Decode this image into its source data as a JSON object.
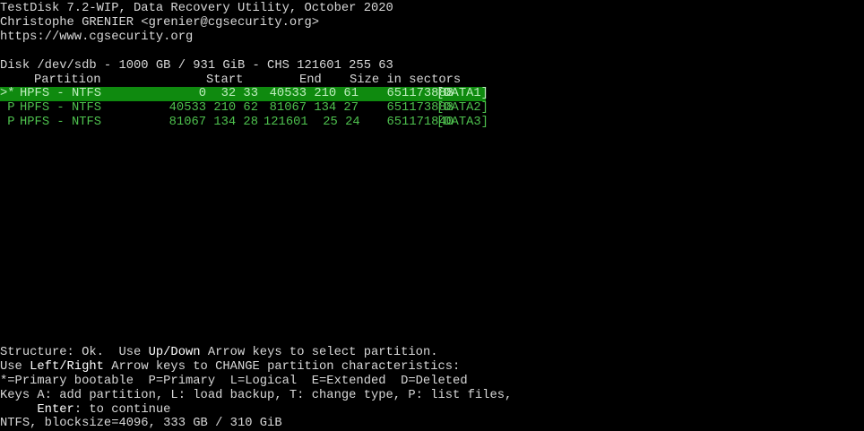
{
  "header": {
    "title": "TestDisk 7.2-WIP, Data Recovery Utility, October 2020",
    "author": "Christophe GRENIER <grenier@cgsecurity.org>",
    "url": "https://www.cgsecurity.org"
  },
  "disk_info": "Disk /dev/sdb - 1000 GB / 931 GiB - CHS 121601 255 63",
  "columns": {
    "partition": "Partition",
    "start": "Start",
    "end": "End",
    "size": "Size in sectors"
  },
  "partitions": [
    {
      "marker": ">*",
      "name": "HPFS - NTFS",
      "start": "0  32 33",
      "end": "40533 210 61",
      "size": "651173888",
      "label": "[DATA1]"
    },
    {
      "marker": " P",
      "name": "HPFS - NTFS",
      "start": "40533 210 62",
      "end": "81067 134 27",
      "size": "651173888",
      "label": "[DATA2]"
    },
    {
      "marker": " P",
      "name": "HPFS - NTFS",
      "start": "81067 134 28",
      "end": "121601  25 24",
      "size": "651171840",
      "label": "[DATA3]"
    }
  ],
  "footer": {
    "structure_prefix": "Structure: Ok.  Use ",
    "updown_keys": "Up/Down",
    "structure_suffix": " Arrow keys to select partition.",
    "use_prefix": "Use ",
    "leftright_keys": "Left/Right",
    "use_suffix": " Arrow keys to CHANGE partition characteristics:",
    "legend": "*=Primary bootable  P=Primary  L=Logical  E=Extended  D=Deleted",
    "keys_help": "Keys A: add partition, L: load backup, T: change type, P: list files,",
    "enter_indent": "     ",
    "enter_key": "Enter",
    "enter_text": ": to continue",
    "fs_info": "NTFS, blocksize=4096, 333 GB / 310 GiB"
  },
  "colors": {
    "background": "#000000",
    "text": "#d8d8d8",
    "partition_text": "#4ec14e",
    "selected_background": "#0f8a0f",
    "selected_text": "#bfeebf"
  }
}
